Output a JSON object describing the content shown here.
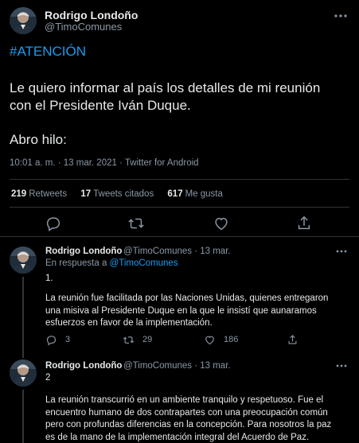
{
  "main_tweet": {
    "author_name": "Rodrigo Londoño",
    "author_handle": "@TimoComunes",
    "more_label": "···",
    "hashtag": "#ATENCIÓN",
    "text_line1": "Le quiero informar al país los detalles de mi reunión",
    "text_line2": "con el Presidente Iván Duque.",
    "text_line3": "Abro hilo:",
    "meta": "10:01 a. m. · 13 mar. 2021 · Twitter for Android",
    "retweets_count": "219",
    "retweets_label": "Retweets",
    "quotes_count": "17",
    "quotes_label": "Tweets citados",
    "likes_count": "617",
    "likes_label": "Me gusta"
  },
  "replies": [
    {
      "author_name": "Rodrigo Londoño",
      "author_handle": "@TimoComunes · 13 mar.",
      "in_reply_prefix": "En respuesta a",
      "in_reply_handle": "@TimoComunes",
      "number": "1.",
      "text_line1": "La reunión fue facilitada por las Naciones Unidas, quienes entregaron",
      "text_line2": "una misiva al Presidente Duque en la que le insistí que aunaramos",
      "text_line3": "esfuerzos en favor de la implementación.",
      "replies_count": "3",
      "retweets_count": "29",
      "likes_count": "186"
    },
    {
      "author_name": "Rodrigo Londoño",
      "author_handle": "@TimoComunes · 13 mar.",
      "number": "2",
      "text_line1": "La reunión transcurrió en un ambiente tranquilo y respetuoso. Fue el",
      "text_line2": "encuentro humano de dos contrapartes con una preocupación común",
      "text_line3": "pero con profundas diferencias en la concepción. Para nosotros la paz",
      "text_line4": "es de la mano de la implementación integral del Acuerdo de Paz."
    }
  ],
  "colors": {
    "background": "#000000",
    "text": "#e7e9ea",
    "secondary": "#8b98a5",
    "accent": "#1d9bf0",
    "divider": "#2f3336"
  },
  "icons": [
    "reply-icon",
    "retweet-icon",
    "like-icon",
    "share-icon",
    "more-icon",
    "avatar"
  ]
}
